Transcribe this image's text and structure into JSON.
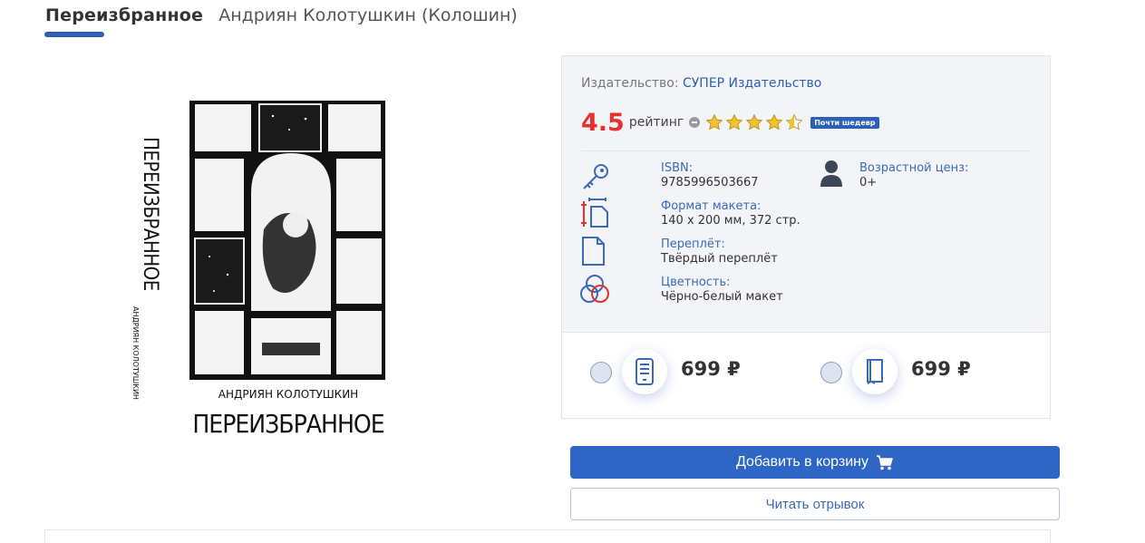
{
  "header": {
    "title": "Переизбранное",
    "author": "Андриян Колотушкин (Колошин)"
  },
  "cover": {
    "author_text": "АНДРИЯН КОЛОТУШКИН",
    "title_text": "ПЕРЕИЗБРАННОЕ",
    "spine_title": "ПЕРЕИЗБРАННОЕ",
    "spine_author": "АНДРИЯН КОЛОТУШКИН"
  },
  "details": {
    "publisher_label": "Издательство:",
    "publisher_name": "СУПЕР Издательство",
    "rating_value": "4.5",
    "rating_word": "рейтинг",
    "rating_score": 4.5,
    "rating_max": 5,
    "badge": "Почти шедевр",
    "isbn_label": "ISBN:",
    "isbn_value": "9785996503667",
    "age_label": "Возрастной ценз:",
    "age_value": "0+",
    "format_label": "Формат макета:",
    "format_value": "140 х 200 мм, 372 стр.",
    "binding_label": "Переплёт:",
    "binding_value": "Твёрдый переплёт",
    "color_label": "Цветность:",
    "color_value": "Чёрно-белый макет"
  },
  "prices": {
    "ebook_price": "699 ₽",
    "print_price": "699 ₽"
  },
  "actions": {
    "add_to_cart": "Добавить в корзину",
    "read_excerpt": "Читать отрывок"
  },
  "colors": {
    "accent": "#2d5fb4",
    "rating": "#e8312c",
    "star": "#f2c230"
  }
}
